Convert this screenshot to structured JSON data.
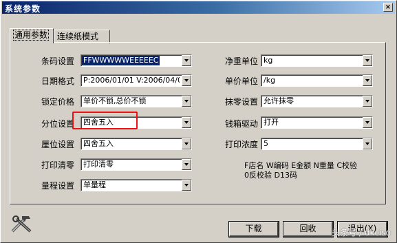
{
  "window": {
    "title": "系统参数",
    "close_glyph": "×"
  },
  "tabs": [
    {
      "label": "通用参数",
      "active": true
    },
    {
      "label": "连续纸模式",
      "active": false
    }
  ],
  "left_fields": [
    {
      "label": "条码设置",
      "value": "FFWWWWWEEEEEC",
      "selected": true
    },
    {
      "label": "日期格式",
      "value": "P:2006/01/01 V:2006/04/0"
    },
    {
      "label": "锁定价格",
      "value": "单价不锁,总价不锁"
    },
    {
      "label": "分位设置",
      "value": "四舍五入"
    },
    {
      "label": "厘位设置",
      "value": "四舍五入"
    },
    {
      "label": "打印清零",
      "value": "打印清零"
    },
    {
      "label": "量程设置",
      "value": "单量程"
    }
  ],
  "right_fields": [
    {
      "label": "净重单位",
      "value": "kg"
    },
    {
      "label": "单价单位",
      "value": "/kg"
    },
    {
      "label": "抹零设置",
      "value": "允许抹零"
    },
    {
      "label": "钱箱驱动",
      "value": "打开"
    },
    {
      "label": "打印浓度",
      "value": "5"
    }
  ],
  "hint": {
    "line1": "F店名 W编码 E金额 N重量 C校验",
    "line2": "0反校验 D13码"
  },
  "buttons": {
    "download": "下载",
    "readback": "回收",
    "exit": "退出(X)"
  },
  "icon": "tools-icon",
  "watermark": "头条号 / dkciso",
  "colors": {
    "titlebar": "#0a246a",
    "face": "#d4d0c8",
    "highlight": "#e11111"
  }
}
